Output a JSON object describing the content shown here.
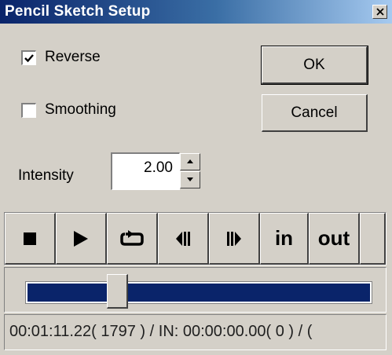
{
  "window": {
    "title": "Pencil Sketch Setup",
    "close_icon": "close-icon"
  },
  "options": {
    "reverse": {
      "label": "Reverse",
      "checked": true
    },
    "smoothing": {
      "label": "Smoothing",
      "checked": false
    }
  },
  "buttons": {
    "ok": "OK",
    "cancel": "Cancel"
  },
  "intensity": {
    "label": "Intensity",
    "value": "2.00"
  },
  "transport": {
    "stop_icon": "stop-icon",
    "play_icon": "play-icon",
    "loop_icon": "loop-icon",
    "prev_frame_icon": "step-back-icon",
    "next_frame_icon": "step-forward-icon",
    "in_label": "in",
    "out_label": "out"
  },
  "timeline": {
    "position_fraction": 0.25,
    "status": "00:01:11.22( 1797 ) / IN: 00:00:00.00( 0 ) / ("
  },
  "colors": {
    "title_bar": "#0a246a",
    "track": "#0a246a",
    "face": "#d4d0c8"
  }
}
